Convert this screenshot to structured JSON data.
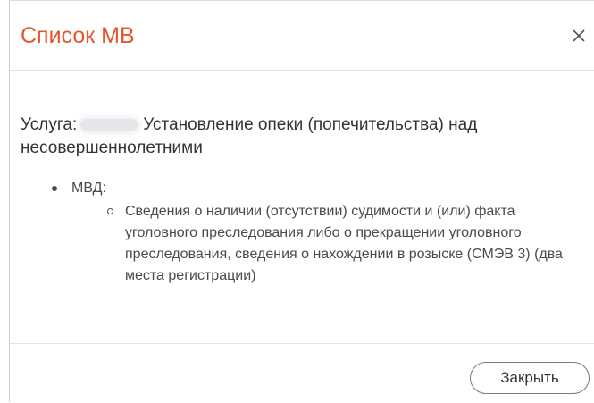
{
  "dialog": {
    "title": "Список МВ",
    "close_icon": "close-icon"
  },
  "body": {
    "service_prefix": "Услуга:",
    "service_name": "Установление опеки (попечительства) над несовершеннолетними",
    "departments": [
      {
        "name": "МВД:",
        "items": [
          "Сведения о наличии (отсутствии) судимости и (или) факта уголовного преследования либо о прекращении уголовного преследования, сведения о нахождении в розыске (СМЭВ 3) (два места регистрации)"
        ]
      }
    ]
  },
  "footer": {
    "close_label": "Закрыть"
  },
  "colors": {
    "title": "#e4572e",
    "text": "#333333",
    "divider": "#e3e3e3"
  }
}
